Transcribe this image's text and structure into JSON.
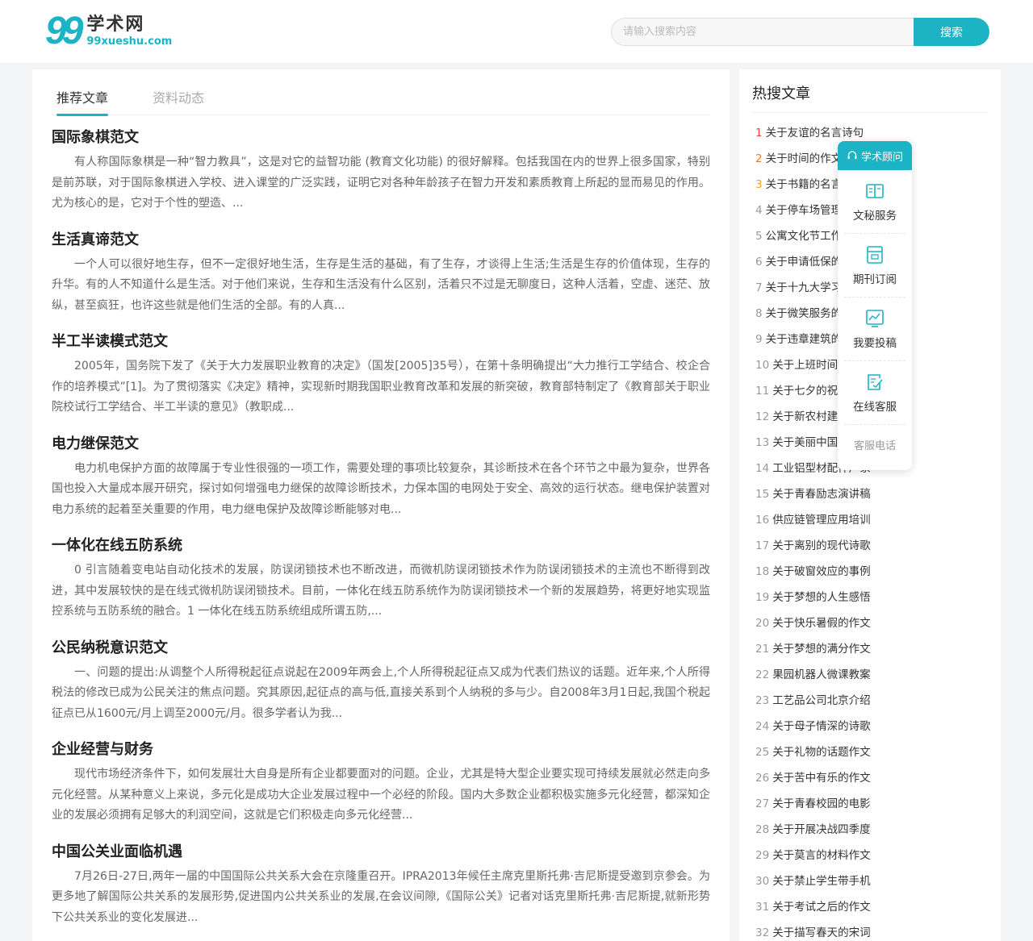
{
  "header": {
    "logo_mark": "99",
    "logo_cn": "学术网",
    "logo_en": "99xueshu.com",
    "search_placeholder": "请输入搜索内容",
    "search_button": "搜索"
  },
  "tabs": [
    {
      "label": "推荐文章",
      "active": true
    },
    {
      "label": "资料动态",
      "active": false
    }
  ],
  "articles": [
    {
      "title": "国际象棋范文",
      "summary": "有人称国际象棋是一种“智力教具”，这是对它的益智功能 (教育文化功能) 的很好解释。包括我国在内的世界上很多国家，特别是前苏联，对于国际象棋进入学校、进入课堂的广泛实践，证明它对各种年龄孩子在智力开发和素质教育上所起的显而易见的作用。尤为核心的是，它对于个性的塑造、..."
    },
    {
      "title": "生活真谛范文",
      "summary": "一个人可以很好地生存，但不一定很好地生活，生存是生活的基础，有了生存，才谈得上生活;生活是生存的价值体现，生存的升华。有的人不知道什么是生活。对于他们来说，生存和生活没有什么区别，活着只不过是无聊度日，这种人活着，空虚、迷茫、放纵，甚至疯狂，也许这些就是他们生活的全部。有的人真..."
    },
    {
      "title": "半工半读模式范文",
      "summary": "2005年，国务院下发了《关于大力发展职业教育的决定》（国发[2005]35号），在第十条明确提出“大力推行工学结合、校企合作的培养模式”[1]。为了贯彻落实《决定》精神，实现新时期我国职业教育改革和发展的新突破，教育部特制定了《教育部关于职业院校试行工学结合、半工半读的意见》（教职成..."
    },
    {
      "title": "电力继保范文",
      "summary": "电力机电保护方面的故障属于专业性很强的一项工作，需要处理的事项比较复杂，其诊断技术在各个环节之中最为复杂，世界各国也投入大量成本展开研究，探讨如何增强电力继保的故障诊断技术，力保本国的电网处于安全、高效的运行状态。继电保护装置对电力系统的起着至关重要的作用，电力继电保护及故障诊断能够对电..."
    },
    {
      "title": "一体化在线五防系统",
      "summary": "0 引言随着变电站自动化技术的发展，防误闭锁技术也不断改进，而微机防误闭锁技术作为防误闭锁技术的主流也不断得到改进，其中发展较快的是在线式微机防误闭锁技术。目前，一体化在线五防系统作为防误闭锁技术一个新的发展趋势，将更好地实现监控系统与五防系统的融合。1 一体化在线五防系统组成所谓五防,..."
    },
    {
      "title": "公民纳税意识范文",
      "summary": "一、问题的提出:从调整个人所得税起征点说起在2009年两会上,个人所得税起征点又成为代表们热议的话题。近年来,个人所得税法的修改已成为公民关注的焦点问题。究其原因,起征点的高与低,直接关系到个人纳税的多与少。自2008年3月1日起,我国个税起征点已从1600元/月上调至2000元/月。很多学者认为我..."
    },
    {
      "title": "企业经营与财务",
      "summary": "现代市场经济条件下，如何发展壮大自身是所有企业都要面对的问题。企业，尤其是特大型企业要实现可持续发展就必然走向多元化经营。从某种意义上来说，多元化是成功大企业发展过程中一个必经的阶段。国内大多数企业都积极实施多元化经营，都深知企业的发展必须拥有足够大的利润空间，这就是它们积极走向多元化经营..."
    },
    {
      "title": "中国公关业面临机遇",
      "summary": "7月26日-27日,两年一届的中国国际公共关系大会在京隆重召开。IPRA2013年候任主席克里斯托弗·吉尼斯提受邀到京参会。为更多地了解国际公共关系的发展形势,促进国内公共关系业的发展,在会议间隙,《国际公关》记者对话克里斯托弗·吉尼斯提,就新形势下公共关系业的变化发展进..."
    }
  ],
  "sidebar": {
    "title": "热搜文章",
    "items": [
      {
        "rank": "1",
        "label": "关于友谊的名言诗句"
      },
      {
        "rank": "2",
        "label": "关于时间的作文"
      },
      {
        "rank": "3",
        "label": "关于书籍的名言"
      },
      {
        "rank": "4",
        "label": "关于停车场管理"
      },
      {
        "rank": "5",
        "label": "公寓文化节工作"
      },
      {
        "rank": "6",
        "label": "关于申请低保的"
      },
      {
        "rank": "7",
        "label": "关于十九大学习"
      },
      {
        "rank": "8",
        "label": "关于微笑服务的"
      },
      {
        "rank": "9",
        "label": "关于违章建筑的"
      },
      {
        "rank": "10",
        "label": "关于上班时间"
      },
      {
        "rank": "11",
        "label": "关于七夕的祝福"
      },
      {
        "rank": "12",
        "label": "关于新农村建设"
      },
      {
        "rank": "13",
        "label": "关于美丽中国"
      },
      {
        "rank": "14",
        "label": "工业铝型材配件厂家"
      },
      {
        "rank": "15",
        "label": "关于青春励志演讲稿"
      },
      {
        "rank": "16",
        "label": "供应链管理应用培训"
      },
      {
        "rank": "17",
        "label": "关于离别的现代诗歌"
      },
      {
        "rank": "18",
        "label": "关于破窗效应的事例"
      },
      {
        "rank": "19",
        "label": "关于梦想的人生感悟"
      },
      {
        "rank": "20",
        "label": "关于快乐暑假的作文"
      },
      {
        "rank": "21",
        "label": "关于梦想的满分作文"
      },
      {
        "rank": "22",
        "label": "果园机器人微课教案"
      },
      {
        "rank": "23",
        "label": "工艺品公司北京介绍"
      },
      {
        "rank": "24",
        "label": "关于母子情深的诗歌"
      },
      {
        "rank": "25",
        "label": "关于礼物的话题作文"
      },
      {
        "rank": "26",
        "label": "关于苦中有乐的作文"
      },
      {
        "rank": "27",
        "label": "关于青春校园的电影"
      },
      {
        "rank": "28",
        "label": "关于开展决战四季度"
      },
      {
        "rank": "29",
        "label": "关于莫言的材料作文"
      },
      {
        "rank": "30",
        "label": "关于禁止学生带手机"
      },
      {
        "rank": "31",
        "label": "关于考试之后的作文"
      },
      {
        "rank": "32",
        "label": "关于描写春天的宋词"
      }
    ]
  },
  "float_panel": {
    "head_label": "学术顾问",
    "items": [
      {
        "label": "文秘服务",
        "icon": "book-icon"
      },
      {
        "label": "期刊订阅",
        "icon": "journal-icon"
      },
      {
        "label": "我要投稿",
        "icon": "submit-chart-icon"
      },
      {
        "label": "在线客服",
        "icon": "edit-doc-icon"
      }
    ],
    "phone_label": "客服电话"
  },
  "colors": {
    "accent": "#1cb4c4",
    "rank1": "#e8473e",
    "rank2": "#f0782a",
    "rank3": "#f5a623"
  }
}
